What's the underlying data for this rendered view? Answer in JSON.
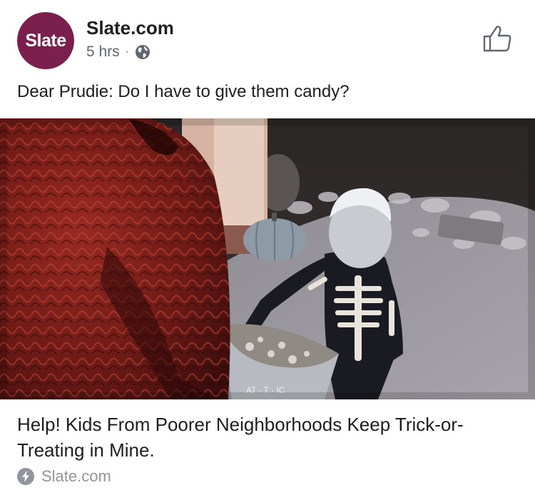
{
  "post": {
    "avatar_text": "Slate",
    "page_name": "Slate.com",
    "time": "5 hrs",
    "separator": "·",
    "privacy_icon": "globe-icon",
    "like_icon": "thumbs-up-icon",
    "message": "Dear Prudie: Do I have to give them candy?"
  },
  "link": {
    "image_description_icon": "photo",
    "title": "Help! Kids From Poorer Neighborhoods Keep Trick-or-Treating in Mine.",
    "source": "Slate.com",
    "source_icon": "lightning-bolt-icon",
    "bowl_text": "AT · T · IC"
  },
  "colors": {
    "avatar": "#7a1f4e",
    "meta": "#606770",
    "source": "#90949c"
  }
}
